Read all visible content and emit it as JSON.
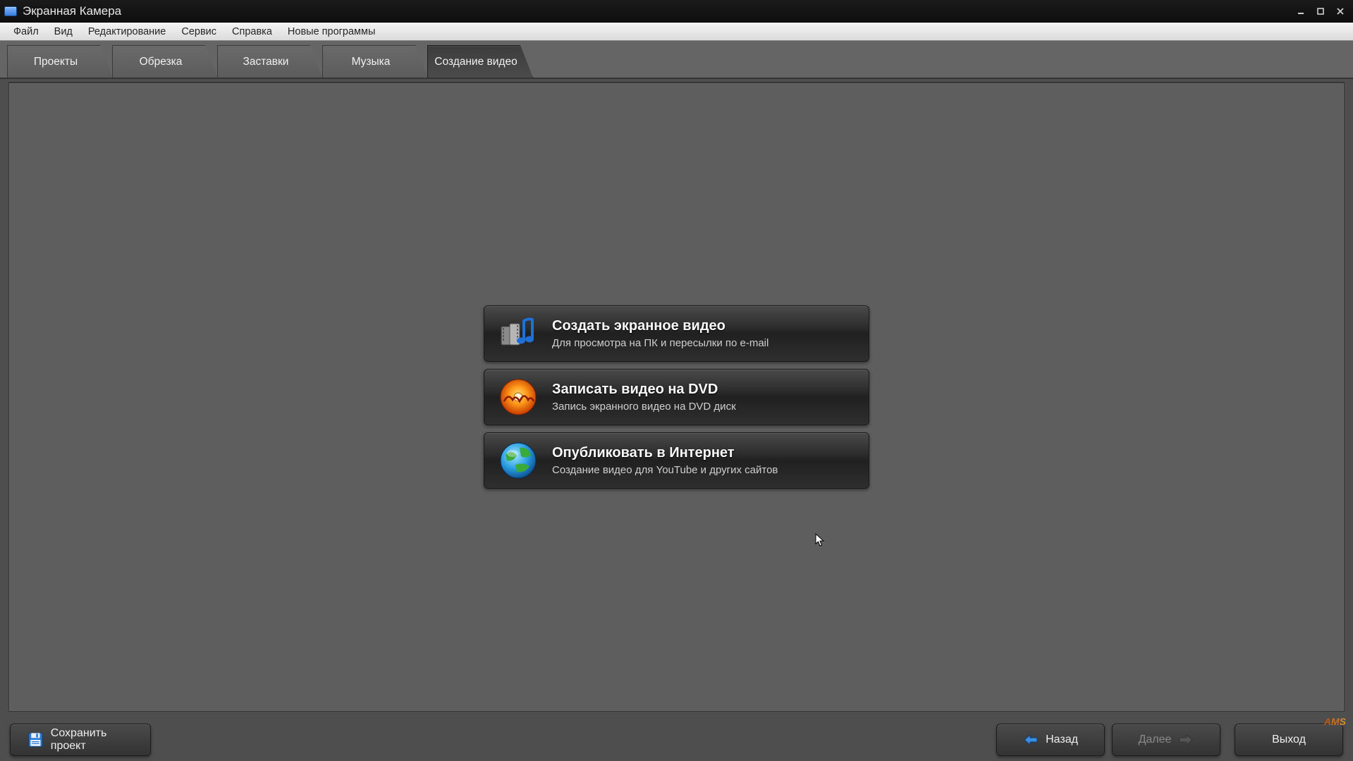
{
  "window": {
    "title": "Экранная Камера"
  },
  "menu": {
    "file": "Файл",
    "view": "Вид",
    "edit": "Редактирование",
    "service": "Сервис",
    "help": "Справка",
    "new_programs": "Новые программы"
  },
  "tabs": {
    "projects": "Проекты",
    "trim": "Обрезка",
    "titles": "Заставки",
    "music": "Музыка",
    "create_video": "Создание видео"
  },
  "cards": {
    "screen_video": {
      "title": "Создать экранное видео",
      "desc": "Для просмотра на ПК и пересылки по e-mail"
    },
    "dvd": {
      "title": "Записать видео на DVD",
      "desc": "Запись экранного видео на DVD диск"
    },
    "publish": {
      "title": "Опубликовать в Интернет",
      "desc": "Создание видео для YouTube и других сайтов"
    }
  },
  "footer": {
    "save_project": "Сохранить проект",
    "back": "Назад",
    "next": "Далее",
    "exit": "Выход",
    "brand": "AMS"
  }
}
